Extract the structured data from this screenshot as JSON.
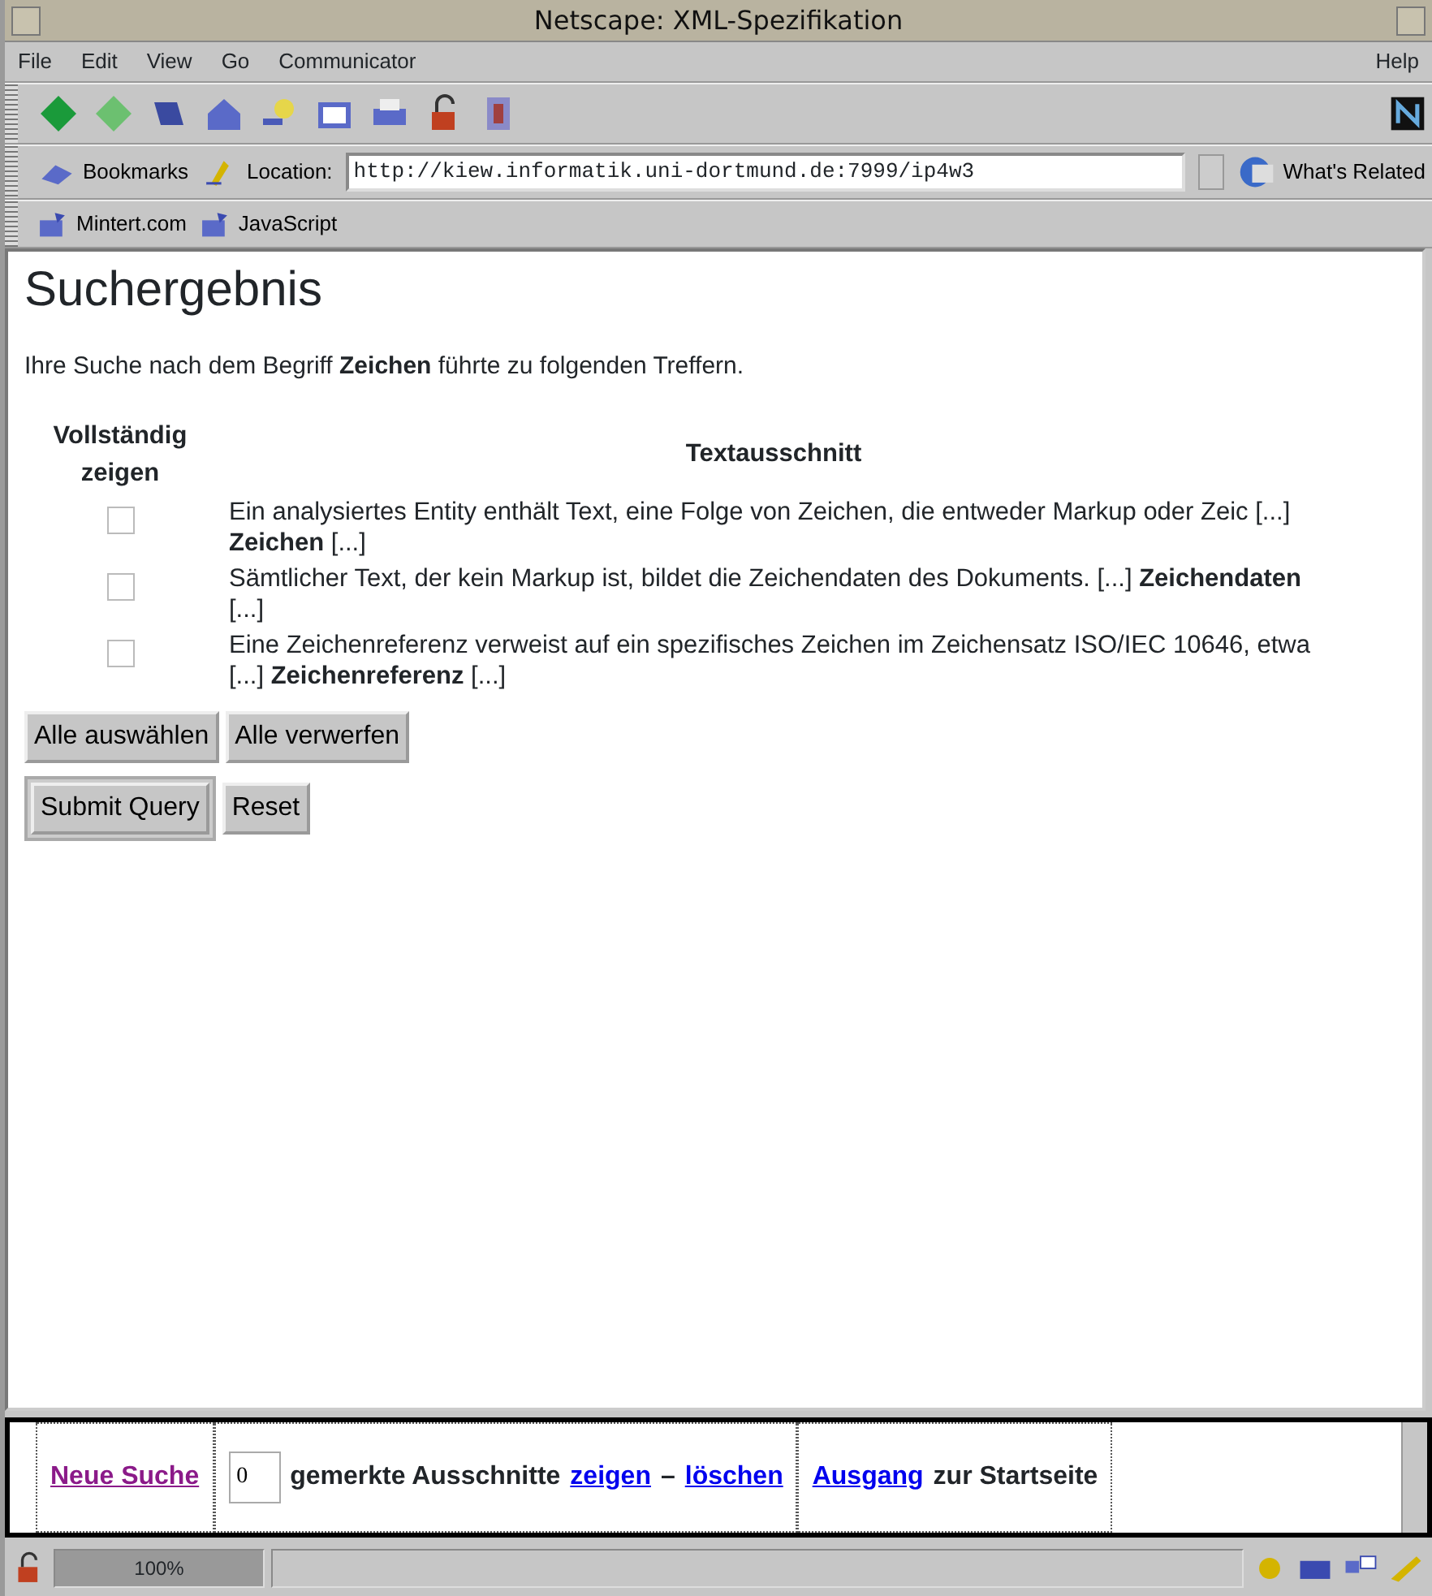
{
  "window": {
    "title": "Netscape: XML-Spezifikation"
  },
  "menu": {
    "items": [
      "File",
      "Edit",
      "View",
      "Go",
      "Communicator"
    ],
    "help": "Help"
  },
  "location_bar": {
    "bookmarks": "Bookmarks",
    "label": "Location:",
    "url": "http://kiew.informatik.uni-dortmund.de:7999/ip4w3",
    "related": "What's Related"
  },
  "personal_toolbar": [
    "Mintert.com",
    "JavaScript"
  ],
  "page": {
    "heading": "Suchergebnis",
    "intro": "Ihre Suche nach dem Begriff **Zeichen** führte zu folgenden Treffern.",
    "columns": [
      "Vollständig zeigen",
      "Textausschnitt"
    ],
    "rows": [
      {
        "checked": false,
        "text": "Ein analysiertes Entity enthält Text, eine Folge von Zeichen, die entweder Markup oder Zeic [...] **Zeichen** [...]"
      },
      {
        "checked": false,
        "text": "Sämtlicher Text, der kein Markup ist, bildet die Zeichendaten des Dokuments. [...] **Zeichendaten** [...]"
      },
      {
        "checked": false,
        "text": "Eine Zeichenreferenz verweist auf ein spezifisches Zeichen im Zeichensatz ISO/IEC 10646, etwa [...] **Zeichenreferenz** [...]"
      }
    ],
    "select_buttons": [
      "Alle auswählen",
      "Alle verwerfen"
    ],
    "form_buttons": [
      {
        "label": "Submit Query",
        "default": true
      },
      {
        "label": "Reset",
        "default": false
      }
    ]
  },
  "bottom_frame": {
    "new_search": {
      "label": "Neue Suche",
      "visited": true
    },
    "count": "0",
    "saved_label": "gemerkte Ausschnitte",
    "show_link": "zeigen",
    "dash": "–",
    "delete_link": "löschen",
    "exit_link": "Ausgang",
    "exit_suffix": "zur Startseite"
  },
  "status_bar": {
    "progress": "100%"
  }
}
